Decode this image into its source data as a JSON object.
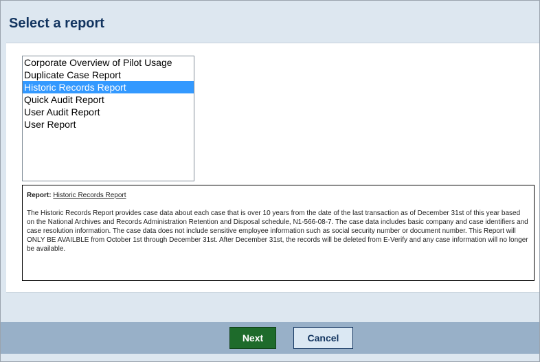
{
  "page": {
    "title": "Select a report"
  },
  "report_list": {
    "items": [
      {
        "label": "Corporate Overview of Pilot Usage",
        "selected": false
      },
      {
        "label": "Duplicate Case Report",
        "selected": false
      },
      {
        "label": "Historic Records Report",
        "selected": true
      },
      {
        "label": "Quick Audit Report",
        "selected": false
      },
      {
        "label": "User Audit Report",
        "selected": false
      },
      {
        "label": "User Report",
        "selected": false
      }
    ]
  },
  "description": {
    "label": "Report:",
    "report_name": "Historic Records Report",
    "text": "The Historic Records Report provides case data about each case that is over 10 years from the date of the last transaction as of December 31st of this year based on the National Archives and Records Administration Retention and Disposal schedule, N1-566-08-7. The case data includes basic company and case identifiers and case resolution information. The case data does not include sensitive employee information such as social security number or document number. This Report will ONLY BE AVAILBLE from October 1st through December 31st. After December 31st, the records will be deleted from E-Verify and any case information will no longer be available."
  },
  "actions": {
    "next_label": "Next",
    "cancel_label": "Cancel"
  },
  "colors": {
    "title": "#12345f",
    "selected_item": "#3399ff",
    "next_button": "#1e6b2b",
    "footer": "#98b0c8"
  }
}
